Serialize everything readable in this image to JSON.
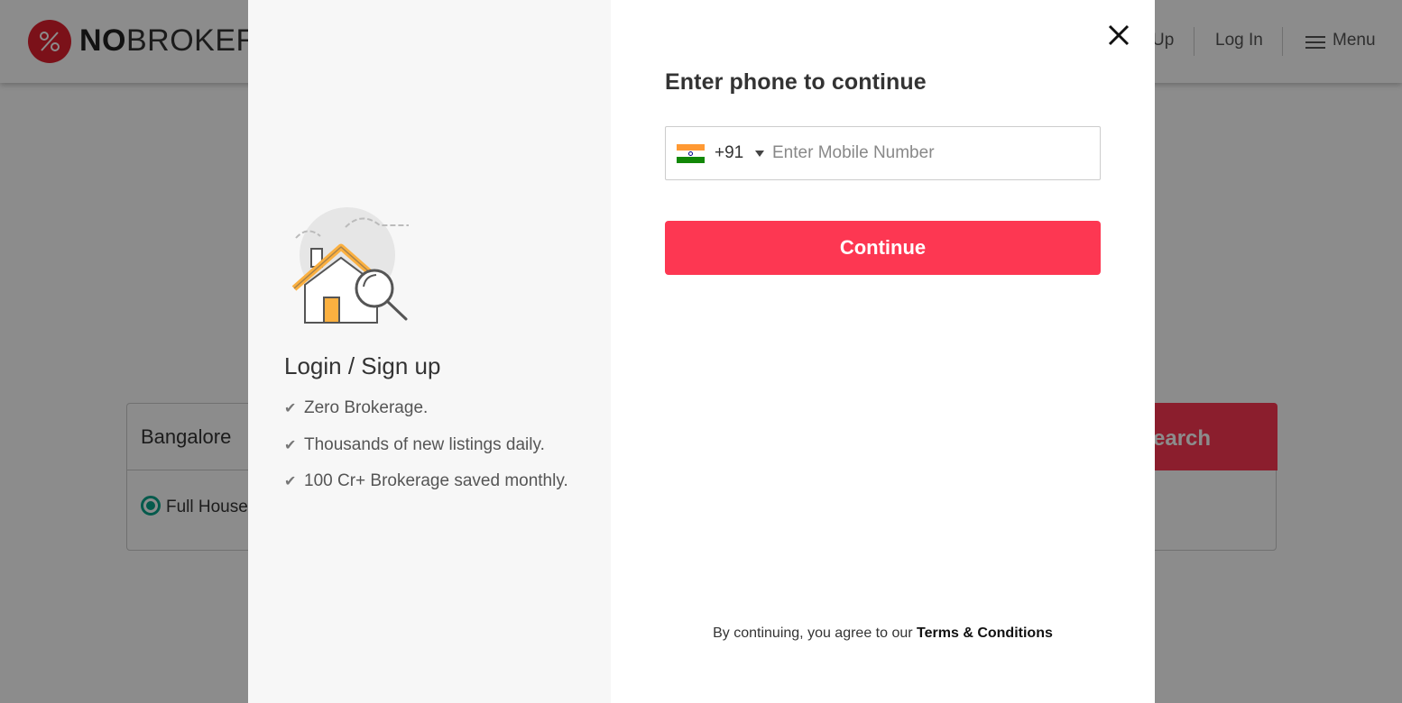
{
  "background": {
    "logo": {
      "bold": "NO",
      "light": "BROKER"
    },
    "nav": {
      "signup_partial": "Up",
      "login": "Log In",
      "menu": "Menu"
    },
    "search": {
      "city": "Bangalore",
      "option": "Full House",
      "button_partial": "earch"
    }
  },
  "modal": {
    "left": {
      "title": "Login / Sign up",
      "benefits": [
        "Zero Brokerage.",
        "Thousands of new listings daily.",
        "100 Cr+ Brokerage saved monthly."
      ]
    },
    "right": {
      "heading": "Enter phone to continue",
      "country_code": "+91",
      "phone_placeholder": "Enter Mobile Number",
      "continue_label": "Continue",
      "terms_prefix": "By continuing, you agree to our",
      "terms_link": "Terms & Conditions"
    }
  },
  "colors": {
    "accent": "#fd3752",
    "brand_red": "#e0202e",
    "radio": "#0aa58a"
  },
  "icons": [
    "logo-icon",
    "menu-icon",
    "close-icon",
    "india-flag-icon",
    "caret-down-icon",
    "house-search-illustration",
    "check-icon"
  ]
}
